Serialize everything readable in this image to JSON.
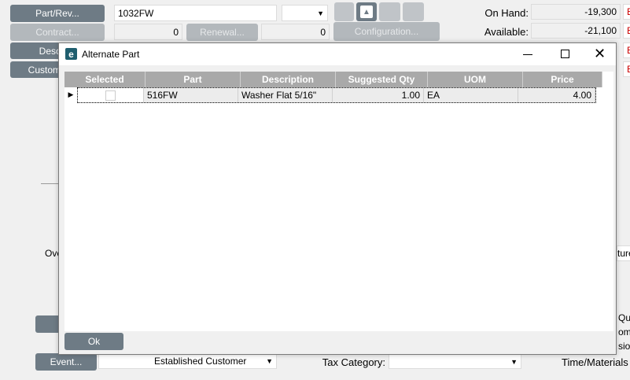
{
  "form": {
    "part_rev_button": "Part/Rev...",
    "part_value": "1032FW",
    "rev_value": "",
    "contract_button": "Contract...",
    "contract_value": "0",
    "renewal_button": "Renewal...",
    "renewal_value": "0",
    "configuration_button": "Configuration...",
    "desc_button": "Desc",
    "customer_button": "Custom",
    "on_hand_label": "On Hand:",
    "on_hand_value": "-19,300",
    "available_label": "Available:",
    "available_value": "-21,100",
    "e_buttons": [
      "E",
      "E",
      "E",
      "E"
    ],
    "ove_label": "Ove",
    "ture_text": "ture",
    "qu_text": "Qu",
    "om_text": "om",
    "sio_text": "sio",
    "event_button": "Event...",
    "event_value": "Established Customer",
    "tax_category_label": "Tax Category:",
    "tax_category_value": "",
    "time_materials_label": "Time/Materials E"
  },
  "dialog": {
    "title": "Alternate Part",
    "columns": [
      "Selected",
      "Part",
      "Description",
      "Suggested Qty",
      "UOM",
      "Price"
    ],
    "rows": [
      {
        "selected": false,
        "part": "516FW",
        "description": "Washer Flat 5/16\"",
        "suggested_qty": "1.00",
        "uom": "EA",
        "price": "4.00"
      }
    ],
    "ok_button": "Ok"
  }
}
